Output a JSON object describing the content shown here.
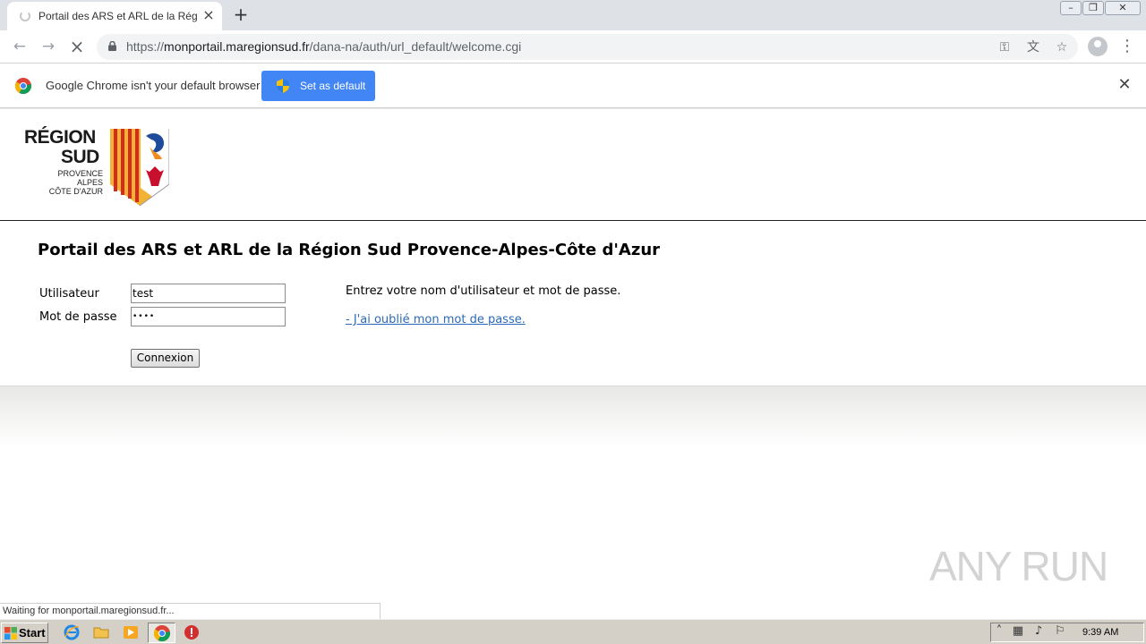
{
  "browser": {
    "tab": {
      "title": "Portail des ARS et ARL de la Région Sud"
    },
    "new_tab_icon": "plus-icon",
    "window_controls": [
      "minimize",
      "restore",
      "close"
    ],
    "url": {
      "protocol": "https://",
      "host": "monportail.maregionsud.fr",
      "path": "/dana-na/auth/url_default/welcome.cgi"
    },
    "infobar": {
      "message": "Google Chrome isn't your default browser",
      "button_label": "Set as default"
    },
    "status_text": "Waiting for monportail.maregionsud.fr..."
  },
  "page": {
    "logo": {
      "line1": "RÉGION",
      "line2": "SUD",
      "line3": "PROVENCE",
      "line4": "ALPES",
      "line5": "CÔTE D'AZUR"
    },
    "title": "Portail des ARS et ARL de la Région Sud Provence-Alpes-Côte d'Azur",
    "form": {
      "username_label": "Utilisateur",
      "username_value": "test",
      "password_label": "Mot de passe",
      "password_value": "••••",
      "submit_label": "Connexion"
    },
    "instructions": "Entrez votre nom d'utilisateur et mot de passe.",
    "forgot_link": "- J'ai oublié mon mot de passe."
  },
  "watermark": "ANY RUN",
  "taskbar": {
    "start_label": "Start",
    "clock": "9:39 AM",
    "pinned": [
      "internet-explorer-icon",
      "folder-icon",
      "media-player-icon",
      "chrome-icon",
      "stop-icon"
    ]
  },
  "colors": {
    "accent_button": "#4285f4",
    "link": "#2a6ab8",
    "taskbar": "#d4d0c8"
  }
}
